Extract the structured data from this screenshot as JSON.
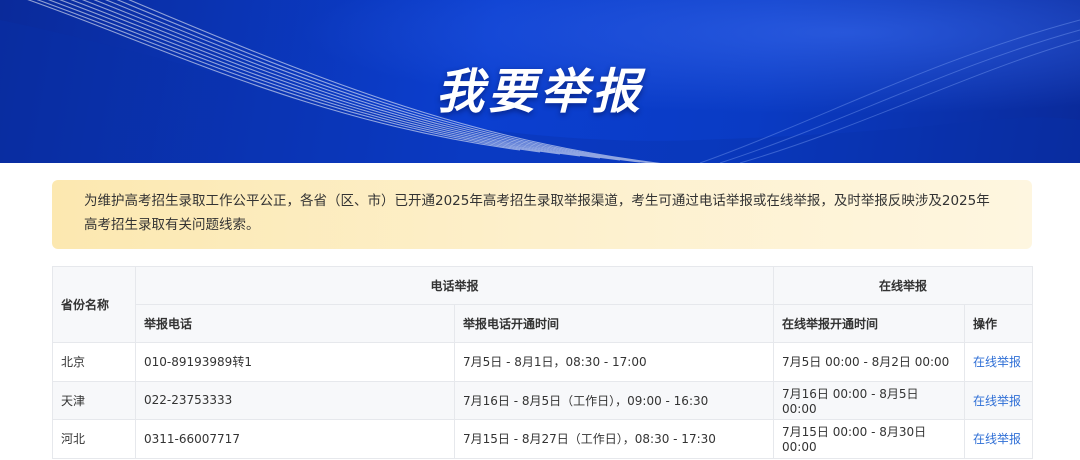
{
  "banner": {
    "title": "我要举报"
  },
  "notice": {
    "text": "为维护高考招生录取工作公平公正，各省（区、市）已开通2025年高考招生录取举报渠道，考生可通过电话举报或在线举报，及时举报反映涉及2025年高考招生录取有关问题线索。"
  },
  "table": {
    "header": {
      "province": "省份名称",
      "phone_group": "电话举报",
      "online_group": "在线举报",
      "phone": "举报电话",
      "phone_time": "举报电话开通时间",
      "online_time": "在线举报开通时间",
      "action": "操作"
    },
    "rows": [
      {
        "province": "北京",
        "phone": "010-89193989转1",
        "phone_time": "7月5日 - 8月1日，08:30 - 17:00",
        "online_time": "7月5日 00:00 - 8月2日 00:00",
        "action": "在线举报"
      },
      {
        "province": "天津",
        "phone": "022-23753333",
        "phone_time": "7月16日 - 8月5日（工作日），09:00 - 16:30",
        "online_time": "7月16日 00:00 - 8月5日 00:00",
        "action": "在线举报"
      },
      {
        "province": "河北",
        "phone": "0311-66007717",
        "phone_time": "7月15日 - 8月27日（工作日），08:30 - 17:30",
        "online_time": "7月15日 00:00 - 8月30日 00:00",
        "action": "在线举报"
      }
    ]
  },
  "colors": {
    "banner": "#0b3fd0",
    "link": "#2f6fd6",
    "notice_bg": "#fce8b0"
  }
}
